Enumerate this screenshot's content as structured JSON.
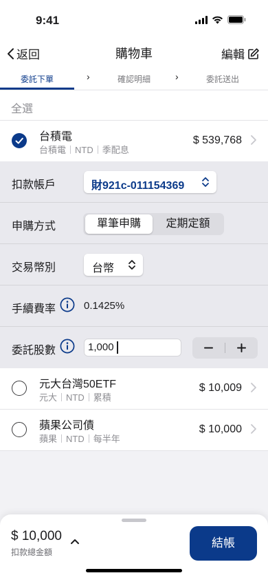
{
  "status_bar": {
    "time": "9:41"
  },
  "nav": {
    "back_label": "返回",
    "title": "購物車",
    "edit_label": "編輯"
  },
  "steps": [
    {
      "label": "委託下單",
      "active": true
    },
    {
      "label": "確認明細",
      "active": false
    },
    {
      "label": "委託送出",
      "active": false
    }
  ],
  "select_all_label": "全選",
  "items": [
    {
      "name": "台積電",
      "meta": [
        "台積電",
        "NTD",
        "季配息"
      ],
      "price": "$ 539,768",
      "checked": true
    },
    {
      "name": "元大台灣50ETF",
      "meta": [
        "元大",
        "NTD",
        "累積"
      ],
      "price": "$ 10,009",
      "checked": false
    },
    {
      "name": "蘋果公司債",
      "meta": [
        "蘋果",
        "NTD",
        "每半年"
      ],
      "price": "$ 10,000",
      "checked": false
    }
  ],
  "detail": {
    "account_label": "扣款帳戶",
    "account_value": "財921c-011154369",
    "method_label": "申購方式",
    "method_options": [
      "單筆申購",
      "定期定額"
    ],
    "method_selected": "單筆申購",
    "currency_label": "交易幣別",
    "currency_value": "台幣",
    "fee_label": "手續費率",
    "fee_value": "0.1425%",
    "qty_label": "委託股數",
    "qty_value": "1,000"
  },
  "footer": {
    "total_amount": "$ 10,000",
    "total_label": "扣款總金額",
    "checkout_label": "結帳"
  },
  "colors": {
    "brand": "#0b3a8a",
    "background": "#f2f2f5",
    "detail_background": "#e9e9ee"
  }
}
